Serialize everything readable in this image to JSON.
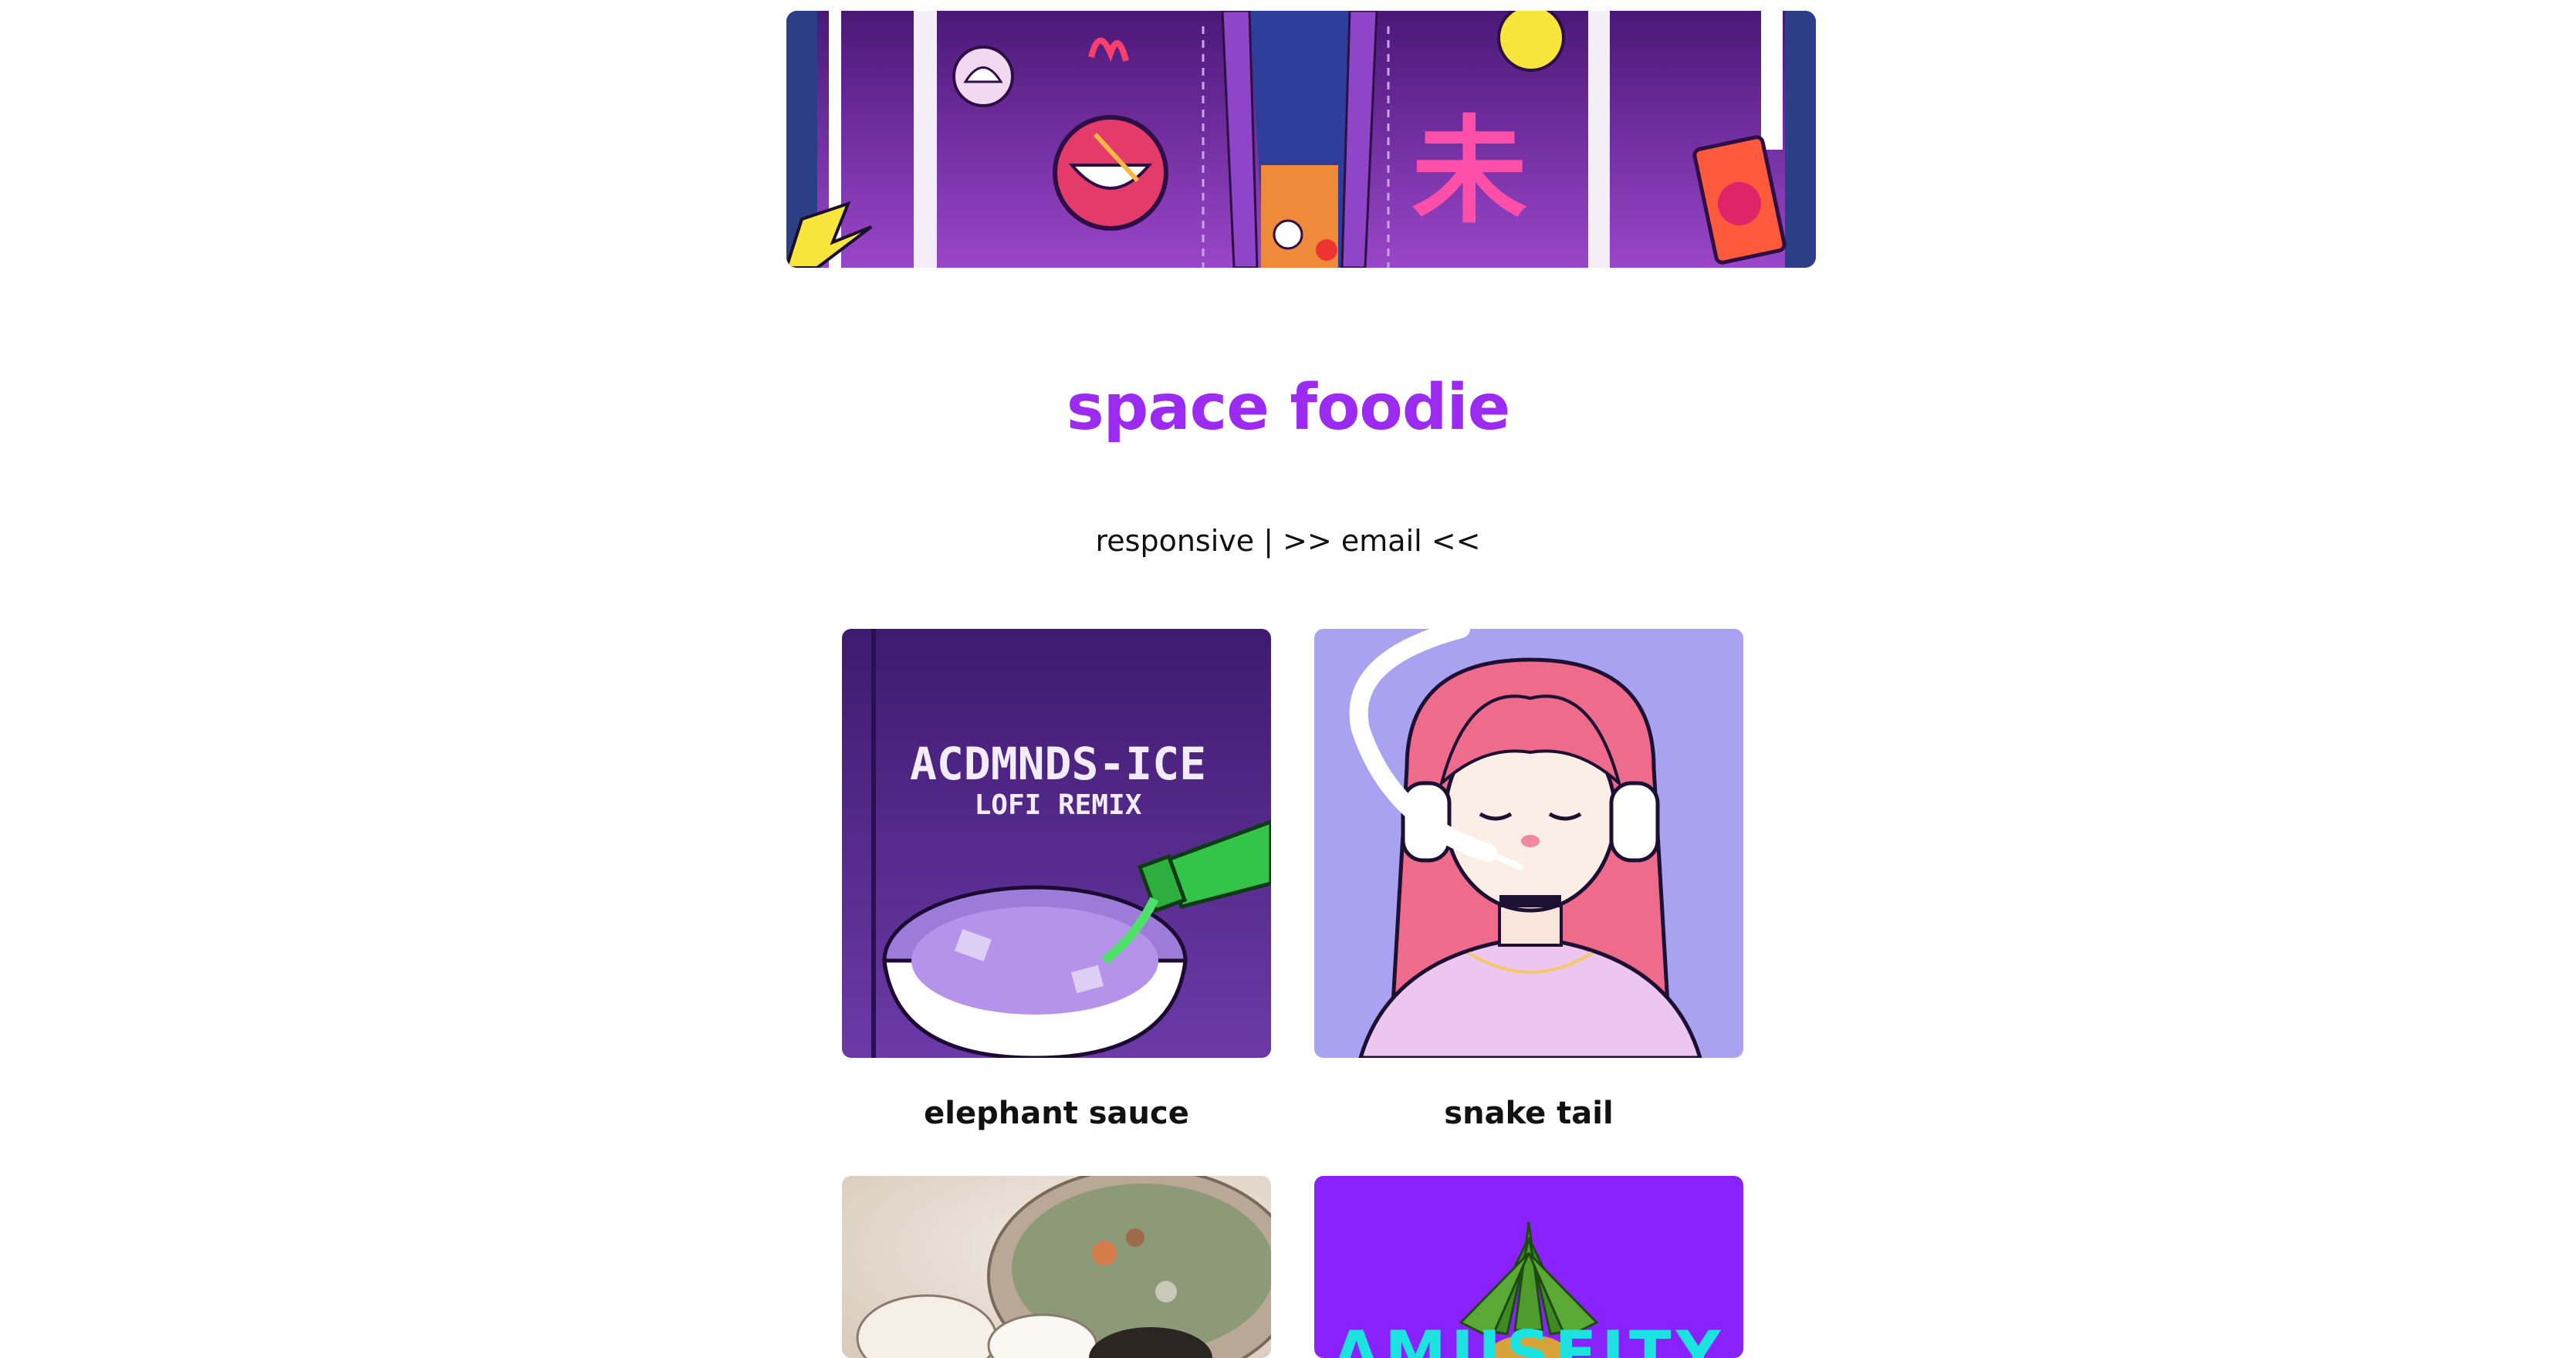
{
  "header": {
    "title": "space foodie",
    "nav": {
      "responsive": "responsive",
      "separator": " | ",
      "email": ">> email <<"
    }
  },
  "hero": {
    "kanji": "未"
  },
  "albums": [
    {
      "title": "elephant sauce",
      "cover_title": "ACDMNDS-ICE",
      "cover_subtitle": "LOFI REMIX"
    },
    {
      "title": "snake tail"
    },
    {
      "title": ""
    },
    {
      "title": "",
      "cover_title": "AMUSEITY"
    }
  ],
  "colors": {
    "accent": "#9b2bf1",
    "hero_purple": "#7b2cb3",
    "cover_purple": "#4d2384",
    "lavender": "#a9a2f0",
    "violet": "#8a22ff"
  }
}
